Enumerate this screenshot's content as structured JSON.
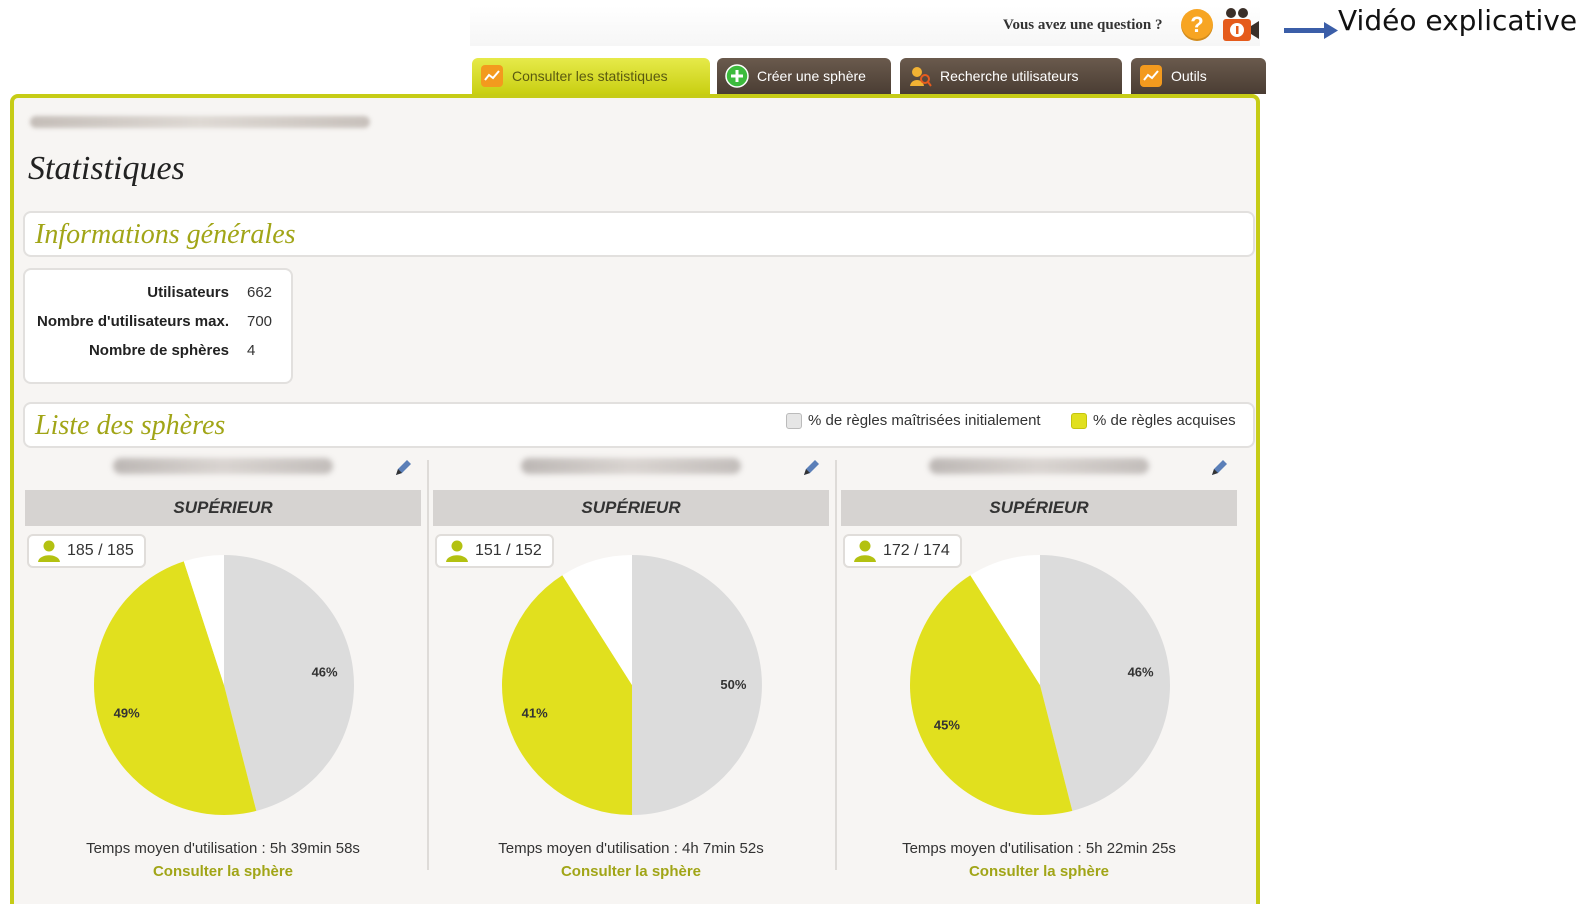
{
  "header": {
    "question_text": "Vous avez une question ?",
    "help_icon": "question-icon",
    "video_icon": "camera-icon",
    "video_label": "Vidéo explicative"
  },
  "tabs": [
    {
      "label": "Consulter les statistiques",
      "icon": "chart-icon",
      "active": true
    },
    {
      "label": "Créer une sphère",
      "icon": "plus-icon",
      "active": false
    },
    {
      "label": "Recherche utilisateurs",
      "icon": "user-search-icon",
      "active": false
    },
    {
      "label": "Outils",
      "icon": "chart-icon",
      "active": false
    }
  ],
  "page": {
    "title": "Statistiques",
    "general_info_title": "Informations générales",
    "spheres_title": "Liste des sphères"
  },
  "general_info": {
    "rows": [
      {
        "label": "Utilisateurs",
        "value": "662"
      },
      {
        "label": "Nombre d'utilisateurs max.",
        "value": "700"
      },
      {
        "label": "Nombre de sphères",
        "value": "4"
      }
    ]
  },
  "legend": {
    "initial": "% de règles maîtrisées initialement",
    "acquired": "% de règles acquises"
  },
  "colors": {
    "accent": "#c9cf12",
    "title_green": "#a1a517",
    "pie_initial": "#dcdcdc",
    "pie_acquired": "#e1e01e",
    "pie_remaining": "#ffffff"
  },
  "spheres": [
    {
      "level": "SUPÉRIEUR",
      "users": "185 / 185",
      "usage": "Temps moyen d'utilisation : 5h 39min 58s",
      "consult": "Consulter la sphère"
    },
    {
      "level": "SUPÉRIEUR",
      "users": "151 / 152",
      "usage": "Temps moyen d'utilisation : 4h 7min 52s",
      "consult": "Consulter la sphère"
    },
    {
      "level": "SUPÉRIEUR",
      "users": "172 / 174",
      "usage": "Temps moyen d'utilisation : 5h 22min 25s",
      "consult": "Consulter la sphère"
    }
  ],
  "chart_data": [
    {
      "type": "pie",
      "categories": [
        "% de règles maîtrisées initialement",
        "% de règles acquises",
        "reste"
      ],
      "values": [
        46,
        49,
        5
      ],
      "labels": [
        "46%",
        "49%",
        ""
      ]
    },
    {
      "type": "pie",
      "categories": [
        "% de règles maîtrisées initialement",
        "% de règles acquises",
        "reste"
      ],
      "values": [
        50,
        41,
        9
      ],
      "labels": [
        "50%",
        "41%",
        ""
      ]
    },
    {
      "type": "pie",
      "categories": [
        "% de règles maîtrisées initialement",
        "% de règles acquises",
        "reste"
      ],
      "values": [
        46,
        45,
        9
      ],
      "labels": [
        "46%",
        "45%",
        ""
      ]
    }
  ]
}
